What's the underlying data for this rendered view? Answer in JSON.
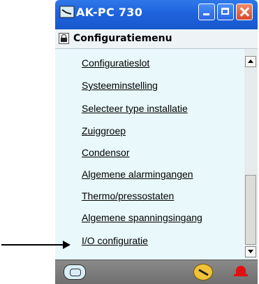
{
  "window": {
    "title": "AK-PC 730",
    "controls": [
      "minimize",
      "maximize",
      "close"
    ]
  },
  "menubar": {
    "title": "Configuratiemenu"
  },
  "menu": {
    "items": [
      "Configuratieslot",
      "Systeeminstelling",
      "Selecteer type installatie",
      "Zuiggroep",
      "Condensor",
      "Algemene alarmingangen",
      "Thermo/pressostaten",
      "Algemene spanningsingang",
      "I/O configuratie"
    ]
  },
  "annotation": {
    "arrow_target": "I/O configuratie"
  },
  "statusbar": {
    "icons": [
      "controller-icon",
      "wrench-icon",
      "alarm-bell-icon"
    ]
  },
  "colors": {
    "titlebar": "#1e63dd",
    "content_background": "#e9f8fb",
    "statusbar": "#7a7a7a",
    "close_button": "#d8492c",
    "alarm": "#e01010"
  }
}
